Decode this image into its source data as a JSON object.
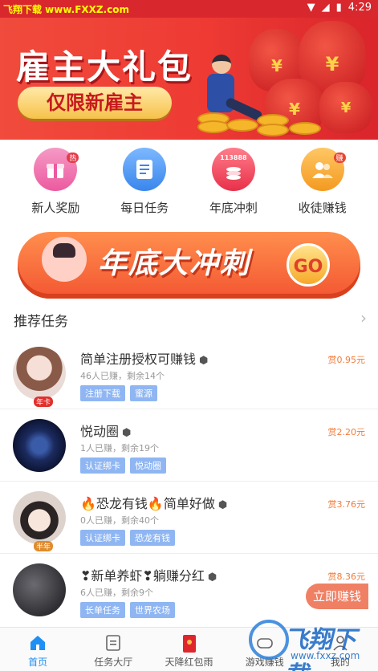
{
  "status_bar": {
    "watermark": "飞翔下载 www.FXXZ.com",
    "time": "4:29"
  },
  "banner": {
    "title": "雇主大礼包",
    "subtitle": "仅限新雇主",
    "coin_symbol": "¥"
  },
  "quick_grid": [
    {
      "label": "新人奖励",
      "icon": "gift-icon",
      "color": "#f06aa8",
      "badge": "热"
    },
    {
      "label": "每日任务",
      "icon": "checklist-icon",
      "color": "#4b9af2",
      "badge": ""
    },
    {
      "label": "年底冲刺",
      "icon": "coin-stack-icon",
      "color": "#f0465c",
      "badge": "",
      "figure": "113888"
    },
    {
      "label": "收徒赚钱",
      "icon": "team-icon",
      "color": "#f5a230",
      "badge": "赚"
    }
  ],
  "promo": {
    "text": "年底大冲刺",
    "go": "GO"
  },
  "section": {
    "title": "推荐任务"
  },
  "tasks": [
    {
      "title": "简单注册授权可赚钱",
      "os": "🤖",
      "reward": "赏0.95元",
      "stats": "46人已赚，剩余14个",
      "tags": [
        "注册下载",
        "蜜源"
      ],
      "avatar_bg": "#e8d0c8",
      "age": "年卡"
    },
    {
      "title": "悦动圈",
      "os": "🤖",
      "reward": "赏2.20元",
      "stats": "1人已赚，剩余19个",
      "tags": [
        "认证绑卡",
        "悦动圈"
      ],
      "avatar_bg": "#1b2a5e",
      "age": ""
    },
    {
      "title": "🔥恐龙有钱🔥简单好做",
      "os": "🤖",
      "reward": "赏3.76元",
      "stats": "0人已赚，剩余40个",
      "tags": [
        "认证绑卡",
        "恐龙有钱"
      ],
      "avatar_bg": "#d9cfc9",
      "age": "半年"
    },
    {
      "title": "❣新单养虾❣躺赚分红",
      "os": "🤖",
      "reward": "赏8.36元",
      "stats": "6人已赚，剩余9个",
      "tags": [
        "长单任务",
        "世界农场"
      ],
      "avatar_bg": "#4a4a4e",
      "age": ""
    }
  ],
  "float_button": {
    "label": "立即赚钱"
  },
  "bottom_nav": [
    {
      "label": "首页",
      "icon": "home-icon",
      "active": true
    },
    {
      "label": "任务大厅",
      "icon": "document-icon",
      "active": false
    },
    {
      "label": "天降红包雨",
      "icon": "red-envelope-icon",
      "active": false
    },
    {
      "label": "游戏赚钱",
      "icon": "gamepad-icon",
      "active": false
    },
    {
      "label": "我的",
      "icon": "user-icon",
      "active": false
    }
  ],
  "watermark": {
    "logo_text": "飞翔下载",
    "url": "www.fxxz.com"
  },
  "colors": {
    "brand_red": "#d8272d",
    "accent_blue": "#1d8ff5",
    "reward_orange": "#f27b3a",
    "tag_blue": "#8fb6f2"
  }
}
